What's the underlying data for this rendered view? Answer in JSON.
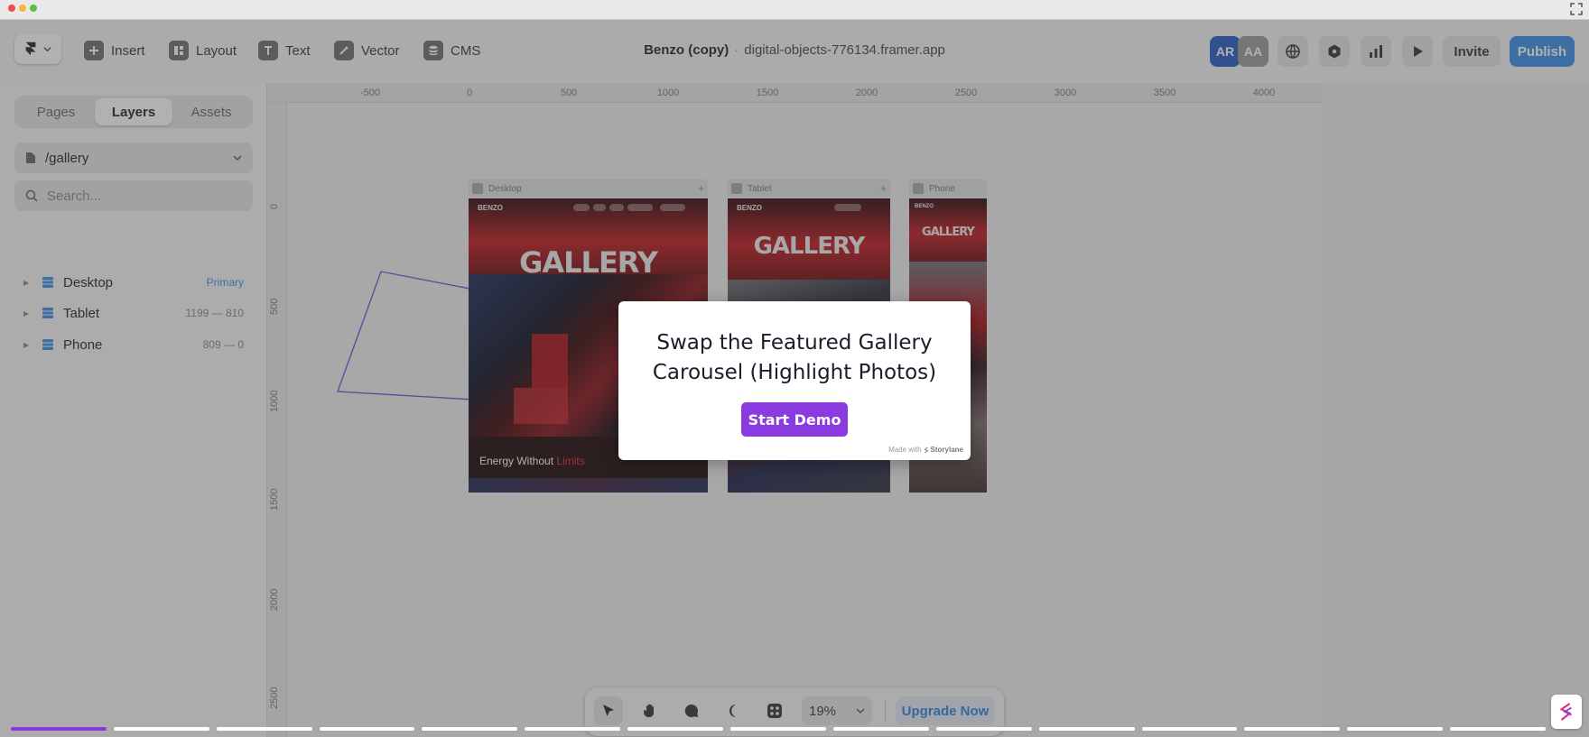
{
  "window": {
    "dot_colors": [
      "#ee4b49",
      "#f5b83a",
      "#58c13f"
    ]
  },
  "toolbar": {
    "tools": [
      {
        "label": "Insert",
        "icon": "plus-icon"
      },
      {
        "label": "Layout",
        "icon": "layout-icon"
      },
      {
        "label": "Text",
        "icon": "text-icon"
      },
      {
        "label": "Vector",
        "icon": "pen-icon"
      },
      {
        "label": "CMS",
        "icon": "database-icon"
      }
    ],
    "project_name": "Benzo (copy)",
    "project_url": "digital-objects-776134.framer.app",
    "avatars": [
      {
        "initials": "AR",
        "color": "#2358c7"
      },
      {
        "initials": "AA",
        "color": "#9a9a9a"
      }
    ],
    "invite_label": "Invite",
    "publish_label": "Publish",
    "colors": {
      "publish": "#3a8de8"
    }
  },
  "sidebar": {
    "tabs": [
      "Pages",
      "Layers",
      "Assets"
    ],
    "active_tab": "Layers",
    "page_path": "/gallery",
    "search_placeholder": "Search...",
    "layers": [
      {
        "name": "Desktop",
        "meta": "Primary"
      },
      {
        "name": "Tablet",
        "meta": "1199 — 810"
      },
      {
        "name": "Phone",
        "meta": "809 — 0"
      }
    ]
  },
  "canvas": {
    "ruler_top": [
      "-500",
      "0",
      "500",
      "1000",
      "1500",
      "2000",
      "2500",
      "3000",
      "3500",
      "4000"
    ],
    "ruler_left": [
      "0",
      "500",
      "1000",
      "1500",
      "2000",
      "2500"
    ],
    "frames": [
      {
        "label": "Desktop",
        "headline": "GALLERY",
        "brand": "BENZO",
        "tagline_prefix": "Energy Without",
        "tagline_accent": "Limits"
      },
      {
        "label": "Tablet",
        "headline": "GALLERY",
        "brand": "BENZO"
      },
      {
        "label": "Phone",
        "headline": "GALLERY",
        "brand": "BENZO"
      }
    ]
  },
  "bottombar": {
    "tools": [
      "cursor-icon",
      "hand-icon",
      "comment-icon",
      "moon-icon",
      "grid-icon"
    ],
    "zoom": "19%",
    "upgrade_label": "Upgrade Now"
  },
  "modal": {
    "title": "Swap the Featured Gallery Carousel (Highlight Photos)",
    "cta": "Start Demo",
    "made_with": "Made with",
    "brand": "Storylane",
    "accent": "#8a3be0"
  },
  "progress": {
    "total_steps": 15,
    "current_step": 1
  }
}
